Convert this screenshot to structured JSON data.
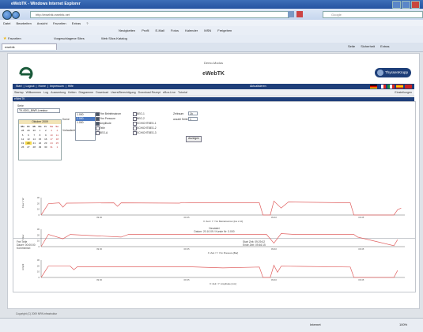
{
  "window": {
    "title": "eWebTK - Windows Internet Explorer"
  },
  "browser": {
    "url": "http://ewebtk.ewebtk.net",
    "search_placeholder": "Google",
    "menu": [
      "Datei",
      "Bearbeiten",
      "Ansicht",
      "Favoriten",
      "Extras",
      "?"
    ],
    "toolbar_items": [
      "Neuigkeiten",
      "Profil",
      "E-Mail",
      "Fotos",
      "Kalender",
      "MSN",
      "Freigeben"
    ],
    "favorites_label": "Favoriten",
    "favorites_links": [
      "Vorgeschlagene Sites",
      "Web Slice-Katalog"
    ],
    "tab_title": "ewebtk",
    "cmd_items": [
      "Seite",
      "Sicherheit",
      "Extras"
    ],
    "status_zone": "Internet",
    "zoom": "100%"
  },
  "page": {
    "demo_label": "Demo-Modus",
    "app_title": "eWebTK",
    "brand": "ThyssenKrupp",
    "nav_main": [
      "Start",
      "Logout",
      "Home",
      "Impressum",
      "Hilfe"
    ],
    "nav_current": "Aktualisieren",
    "nav_sub": [
      "Startup",
      "Willkommen",
      "Log",
      "Auswertung",
      "Ketten",
      "Diagramme",
      "Download",
      "Users/Berechtigung",
      "Download Rezept",
      "eBox-Live",
      "Tutorial"
    ],
    "nav_settings": "Einstellungen",
    "section_title": "eWebTK",
    "form": {
      "serie_label": "Serie",
      "serie_value": "TK-0001_BWR-Leesbur",
      "kurve_label": "Kurve",
      "vorlaufzeit_label": "Vorlaufzeit",
      "list_values": [
        "1.000",
        "1.000",
        "1.000"
      ],
      "calendar_title": "Oktober 2009",
      "calendar_days": [
        "Mo",
        "Di",
        "Mi",
        "Do",
        "Fr",
        "Sa",
        "So"
      ],
      "calendar_weeks": [
        [
          "28",
          "29",
          "30",
          "1",
          "2",
          "3",
          "4"
        ],
        [
          "5",
          "6",
          "7",
          "8",
          "9",
          "10",
          "11"
        ],
        [
          "12",
          "13",
          "14",
          "15",
          "16",
          "17",
          "18"
        ],
        [
          "19",
          "20",
          "21",
          "22",
          "23",
          "24",
          "25"
        ],
        [
          "26",
          "27",
          "28",
          "29",
          "30",
          "31",
          "1"
        ]
      ],
      "calendar_today": "20",
      "checkboxes_col1": [
        {
          "label": "Ytm Betriebsstrom",
          "checked": true
        },
        {
          "label": "Ytm Pressure",
          "checked": true
        },
        {
          "label": "Amplitude",
          "checked": true
        },
        {
          "label": "Teile",
          "checked": false
        },
        {
          "label": "BEO-A",
          "checked": false
        }
      ],
      "checkboxes_col2": [
        {
          "label": "BEO-1",
          "checked": false
        },
        {
          "label": "BEO-2",
          "checked": false
        },
        {
          "label": "SCHICHTBEG-1",
          "checked": false
        },
        {
          "label": "SCHICHTBEG-2",
          "checked": false
        },
        {
          "label": "SCHICHTBEG-3",
          "checked": false
        }
      ],
      "zeitraum_label": "Zeitraum",
      "zeitraum_value": "1h",
      "anzahl_label": "anzahl Seite",
      "anzahl_value": "1",
      "anzeigen_label": "Anzeigen"
    },
    "meta_center_1": "Neudatei",
    "meta_center_2": "Datum: 20.10.09 / Kunde Nr: 3.000",
    "info_left": [
      "Frei Teile",
      "Dauer: 00:00:00",
      "Kommentar:"
    ],
    "info_right": [
      "Start Zeit: 09:29:02",
      "Ende Zeit: 09:46:15"
    ],
    "charts": [
      {
        "ylabel": "Flow 1 W",
        "caption": "X: Zeit / Y: Ytm Betriebsstrom [kw x 10]",
        "x_ticks": [
          "09:30",
          "09:35",
          "09:40",
          "09:45"
        ],
        "y_ticks": [
          "30",
          "20",
          "10",
          "0"
        ]
      },
      {
        "ylabel": "Flow",
        "caption": "X: Zeit / Y: Ytm Pressure [Bar]",
        "x_ticks": [
          "09:30",
          "09:35",
          "09:40",
          "09:45"
        ],
        "y_ticks": [
          "30",
          "20",
          "10",
          "0"
        ]
      },
      {
        "ylabel": "Amplit",
        "caption": "X: Zeit / Y: Amplitude [mm]",
        "x_ticks": [
          "09:30",
          "09:35",
          "09:40",
          "09:45"
        ],
        "y_ticks": [
          "30",
          "20",
          "10",
          "0"
        ]
      }
    ],
    "footer": "Copyright (C) 2009 MPA Infrastruktur"
  },
  "colors": {
    "nav": "#1f3f7a",
    "series": "#e06060",
    "brand": "#1d3e78"
  }
}
